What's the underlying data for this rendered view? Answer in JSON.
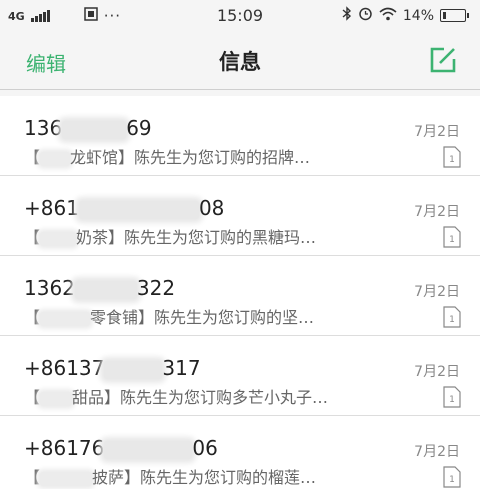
{
  "status": {
    "network": "4G",
    "time": "15:09",
    "battery": "14%",
    "battery_level": 0.14
  },
  "nav": {
    "edit_label": "编辑",
    "title": "信息"
  },
  "messages": [
    {
      "sender_start": "136",
      "sender_end": "69",
      "preview_start": "【",
      "preview_end": "龙虾馆】陈先生为您订购的招牌…",
      "date": "7月2日"
    },
    {
      "sender_start": "+861",
      "sender_end": "08",
      "preview_start": "【",
      "preview_end": "奶茶】陈先生为您订购的黑糖玛…",
      "date": "7月2日"
    },
    {
      "sender_start": "1362",
      "sender_end": "322",
      "preview_start": "【",
      "preview_end": "零食铺】陈先生为您订购的坚…",
      "date": "7月2日"
    },
    {
      "sender_start": "+86137",
      "sender_end": "317",
      "preview_start": "【",
      "preview_end": "甜品】陈先生为您订购多芒小丸子…",
      "date": "7月2日"
    },
    {
      "sender_start": "+86176",
      "sender_end": "06",
      "preview_start": "【",
      "preview_end": "披萨】陈先生为您订购的榴莲…",
      "date": "7月2日"
    }
  ],
  "sim_indicator": "1",
  "colors": {
    "accent": "#3cb371"
  }
}
